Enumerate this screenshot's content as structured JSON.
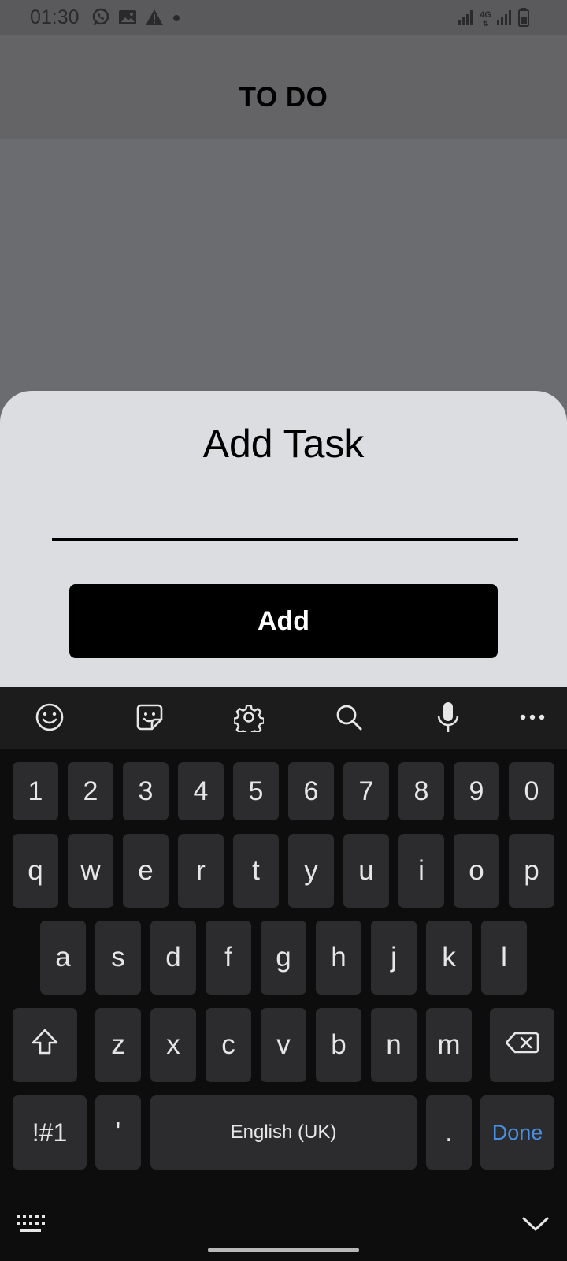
{
  "status_bar": {
    "time": "01:30",
    "left_icons": [
      "whatsapp-icon",
      "image-icon",
      "warning-icon",
      "dot-icon"
    ],
    "right_icons": [
      "signal-icon",
      "network-4g-icon",
      "signal-icon",
      "battery-icon"
    ],
    "network_label": "4G"
  },
  "app_bar": {
    "title": "TO DO"
  },
  "sheet": {
    "title": "Add Task",
    "input_value": "",
    "input_placeholder": "",
    "add_label": "Add"
  },
  "keyboard": {
    "toolbar_icons": [
      "emoji-icon",
      "sticker-icon",
      "settings-icon",
      "search-icon",
      "mic-icon",
      "more-icon"
    ],
    "row_digits": [
      "1",
      "2",
      "3",
      "4",
      "5",
      "6",
      "7",
      "8",
      "9",
      "0"
    ],
    "row_1": [
      "q",
      "w",
      "e",
      "r",
      "t",
      "y",
      "u",
      "i",
      "o",
      "p"
    ],
    "row_2": [
      "a",
      "s",
      "d",
      "f",
      "g",
      "h",
      "j",
      "k",
      "l"
    ],
    "row_3": [
      "z",
      "x",
      "c",
      "v",
      "b",
      "n",
      "m"
    ],
    "symbols_label": "!#1",
    "apostrophe_label": "'",
    "space_label": "English (UK)",
    "period_label": ".",
    "done_label": "Done",
    "accent_color": "#4a90e2"
  }
}
